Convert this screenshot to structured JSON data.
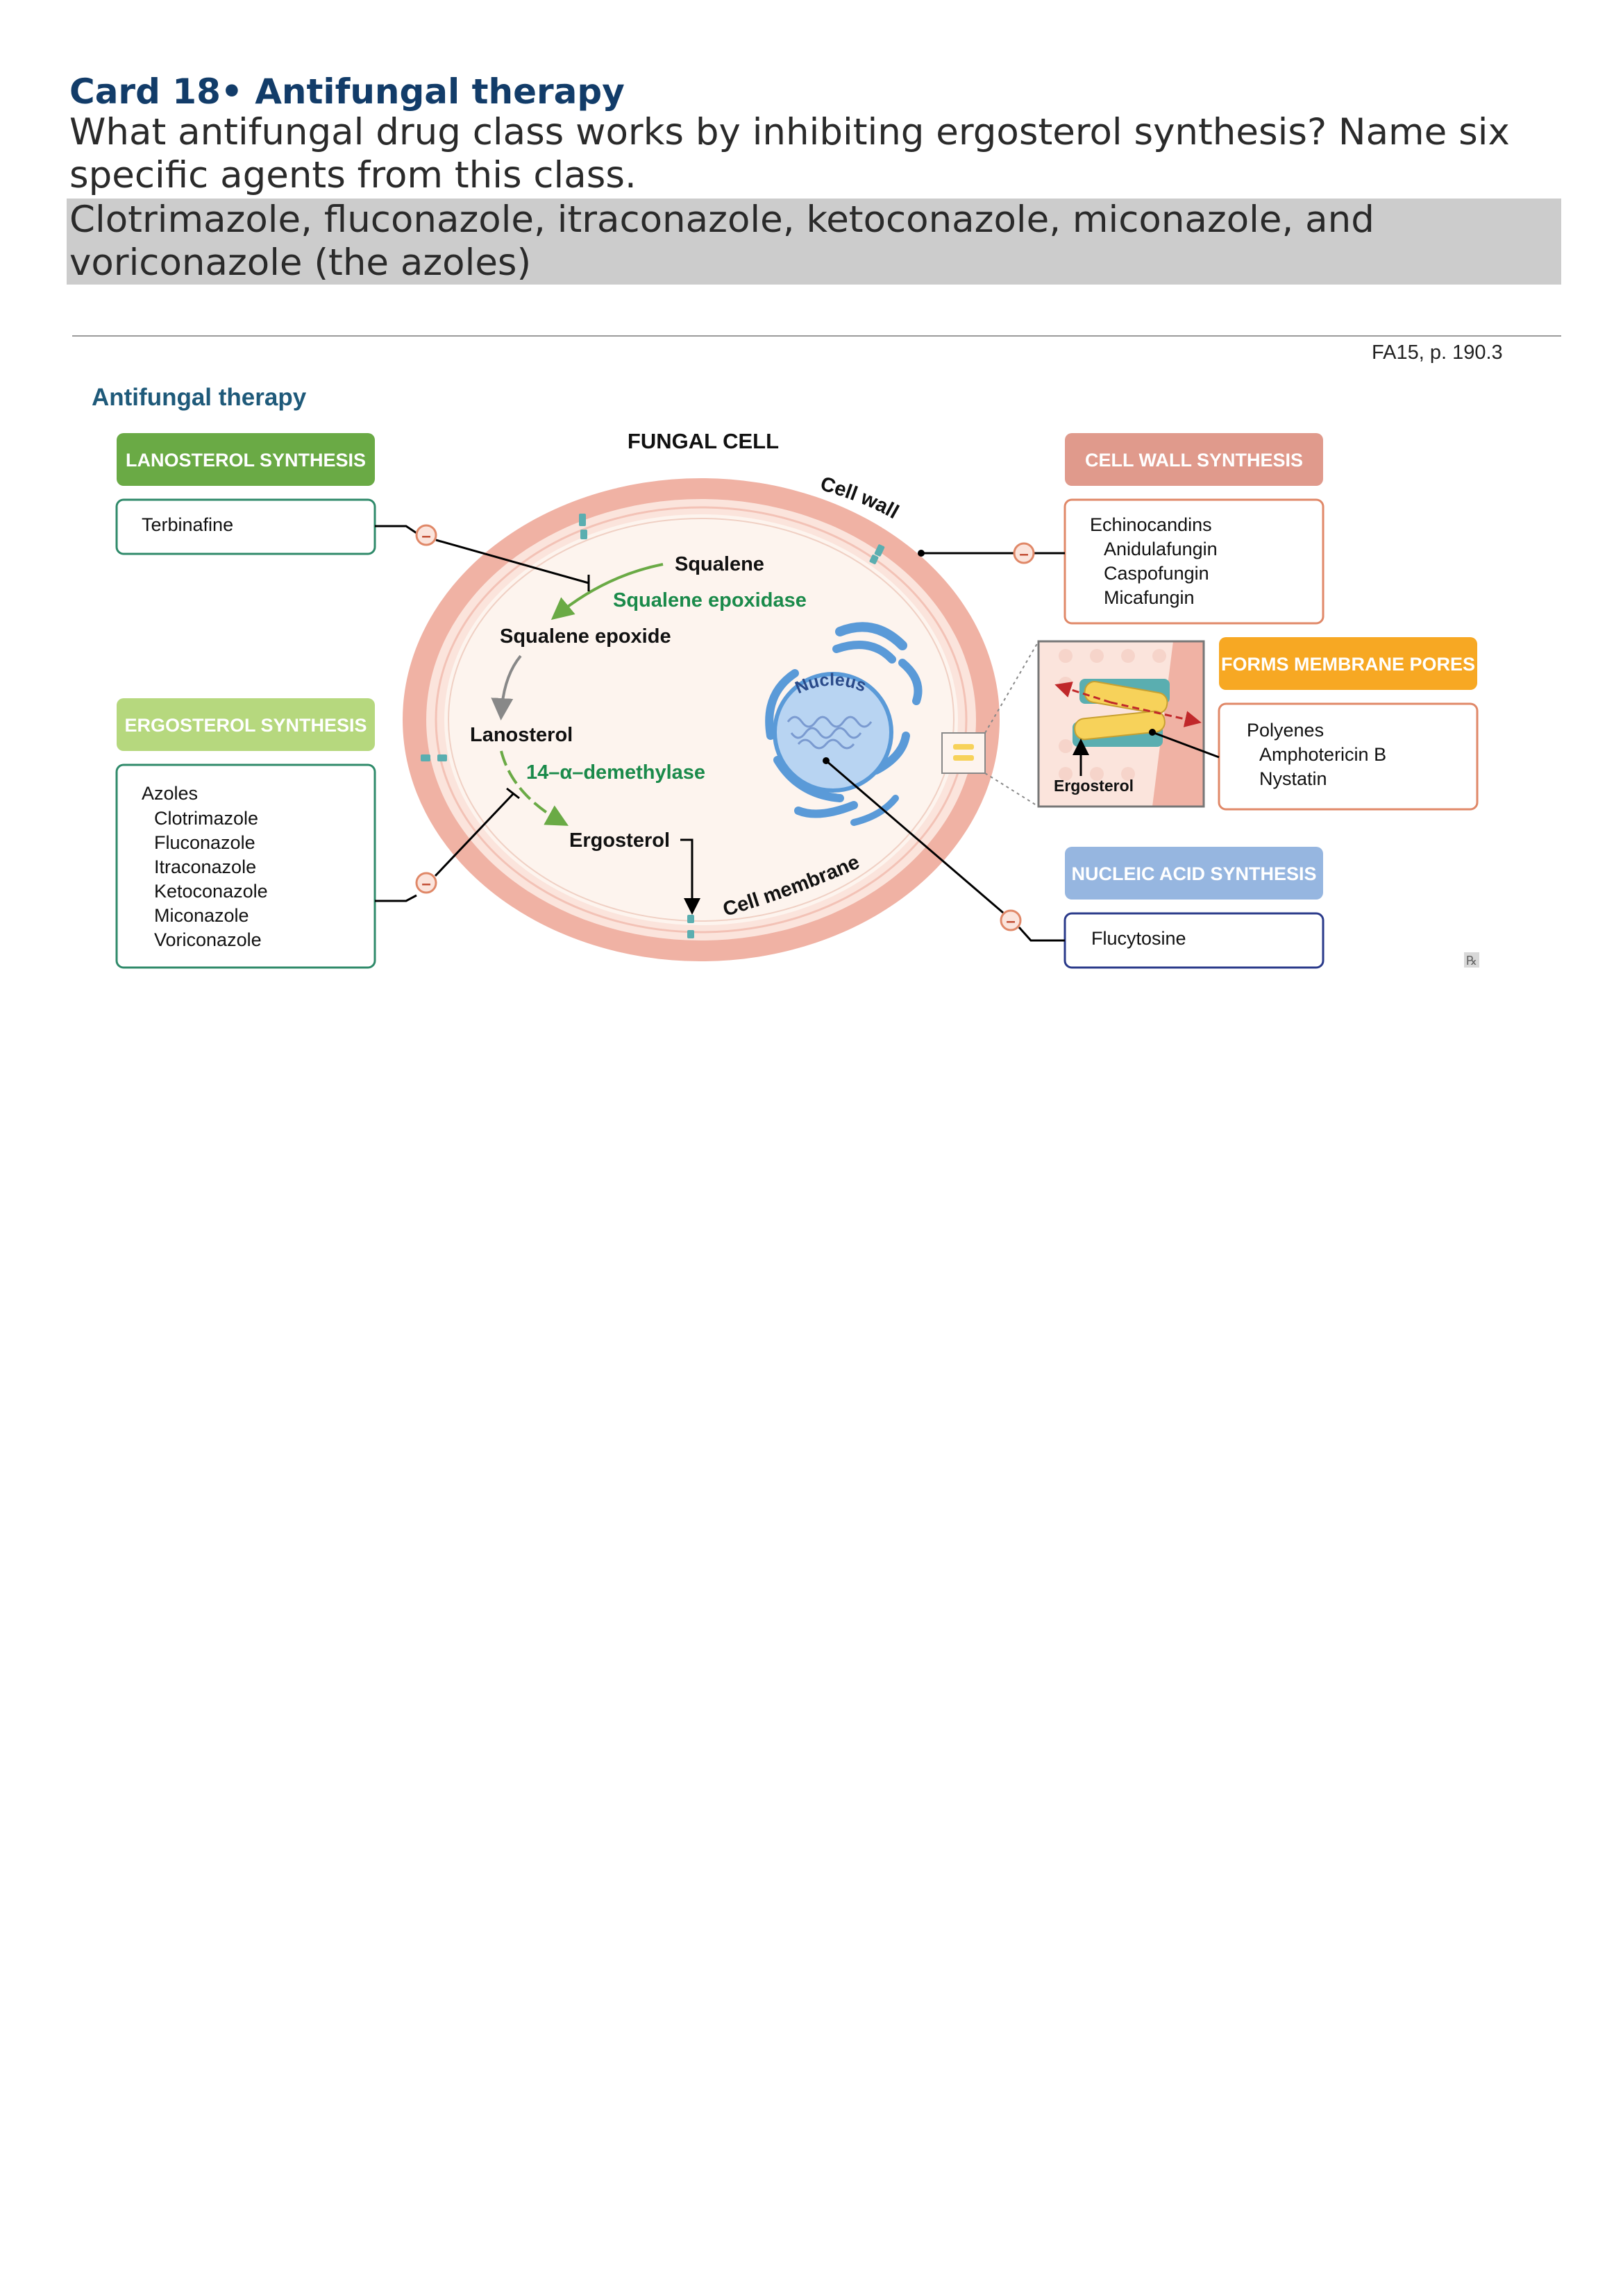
{
  "card": {
    "title": "Card 18• Antifungal therapy",
    "question": "What antifungal drug class works by inhibiting ergosterol synthesis? Name six specific agents from this class.",
    "answer": "Clotrimazole, fluconazole, itraconazole, ketoconazole, miconazole, and voriconazole (the azoles)",
    "reference": "FA15, p. 190.3"
  },
  "figure": {
    "heading": "Antifungal therapy",
    "cell_title": "FUNGAL CELL",
    "labels": {
      "cell_wall": "Cell wall",
      "cell_membrane": "Cell membrane",
      "nucleus": "Nucleus",
      "squalene": "Squalene",
      "squalene_epoxidase": "Squalene epoxidase",
      "squalene_epoxide": "Squalene epoxide",
      "lanosterol": "Lanosterol",
      "demethylase": "14–α–demethylase",
      "ergosterol": "Ergosterol",
      "inset_ergosterol": "Ergosterol",
      "inhibit_symbol": "–"
    },
    "panels": {
      "lanosterol_synthesis": {
        "header": "LANOSTEROL SYNTHESIS",
        "drugs": [
          "Terbinafine"
        ]
      },
      "ergosterol_synthesis": {
        "header": "ERGOSTEROL SYNTHESIS",
        "class": "Azoles",
        "drugs": [
          "Clotrimazole",
          "Fluconazole",
          "Itraconazole",
          "Ketoconazole",
          "Miconazole",
          "Voriconazole"
        ]
      },
      "cell_wall_synthesis": {
        "header": "CELL WALL SYNTHESIS",
        "class": "Echinocandins",
        "drugs": [
          "Anidulafungin",
          "Caspofungin",
          "Micafungin"
        ]
      },
      "membrane_pores": {
        "header": "FORMS MEMBRANE PORES",
        "class": "Polyenes",
        "drugs": [
          "Amphotericin B",
          "Nystatin"
        ]
      },
      "nucleic_acid_synthesis": {
        "header": "NUCLEIC ACID SYNTHESIS",
        "drugs": [
          "Flucytosine"
        ]
      }
    },
    "rx_mark": "℞",
    "colors": {
      "lanosterol_header": "#6aaa45",
      "ergosterol_header": "#b6d87e",
      "cell_wall_header": "#e09a8c",
      "membrane_pores_header": "#f7a823",
      "nucleic_header": "#96b6e0",
      "heading": "#1f5a7a",
      "enzyme_green": "#1a8a4a",
      "cell_wall": "#f0b2a4",
      "nucleus": "#5a9ad8"
    }
  }
}
